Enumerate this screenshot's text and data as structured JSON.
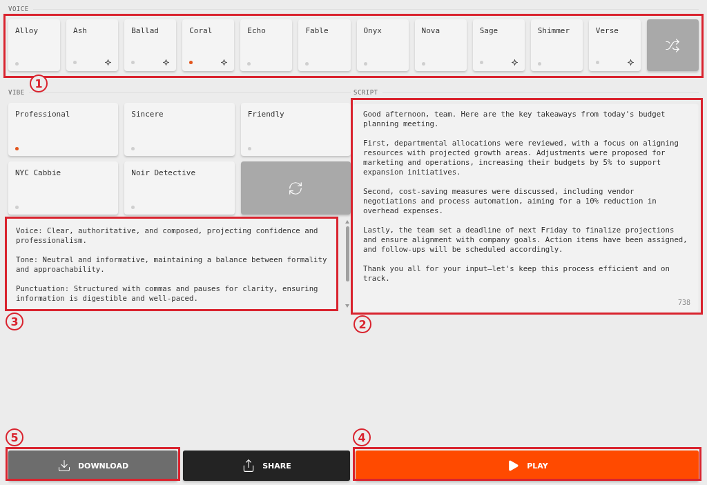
{
  "voice": {
    "heading": "VOICE",
    "annotation": "1",
    "options": [
      {
        "name": "Alloy",
        "selected": false,
        "sparkle": false
      },
      {
        "name": "Ash",
        "selected": false,
        "sparkle": true
      },
      {
        "name": "Ballad",
        "selected": false,
        "sparkle": true
      },
      {
        "name": "Coral",
        "selected": true,
        "sparkle": true
      },
      {
        "name": "Echo",
        "selected": false,
        "sparkle": false
      },
      {
        "name": "Fable",
        "selected": false,
        "sparkle": false
      },
      {
        "name": "Onyx",
        "selected": false,
        "sparkle": false
      },
      {
        "name": "Nova",
        "selected": false,
        "sparkle": false
      },
      {
        "name": "Sage",
        "selected": false,
        "sparkle": true
      },
      {
        "name": "Shimmer",
        "selected": false,
        "sparkle": false
      },
      {
        "name": "Verse",
        "selected": false,
        "sparkle": true
      }
    ]
  },
  "vibe": {
    "heading": "VIBE",
    "options": [
      {
        "name": "Professional",
        "selected": true
      },
      {
        "name": "Sincere",
        "selected": false
      },
      {
        "name": "Friendly",
        "selected": false
      },
      {
        "name": "NYC Cabbie",
        "selected": false
      },
      {
        "name": "Noir Detective",
        "selected": false
      }
    ],
    "description": {
      "annotation": "3",
      "paragraphs": [
        "Voice: Clear, authoritative, and composed, projecting confidence and professionalism.",
        "Tone: Neutral and informative, maintaining a balance between formality and approachability.",
        "Punctuation: Structured with commas and pauses for clarity, ensuring information is digestible and well-paced."
      ]
    }
  },
  "script": {
    "heading": "SCRIPT",
    "annotation": "2",
    "paragraphs": [
      "Good afternoon, team. Here are the key takeaways from today's budget planning meeting.",
      "First, departmental allocations were reviewed, with a focus on aligning resources with projected growth areas. Adjustments were proposed for marketing and operations, increasing their budgets by 5% to support expansion initiatives.",
      "Second, cost-saving measures were discussed, including vendor negotiations and process automation, aiming for a 10% reduction in overhead expenses.",
      "Lastly, the team set a deadline of next Friday to finalize projections and ensure alignment with company goals. Action items have been assigned, and follow-ups will be scheduled accordingly.",
      "Thank you all for your input—let's keep this process efficient and on track."
    ],
    "char_count": "738"
  },
  "actions": [
    {
      "kind": "download",
      "label": "DOWNLOAD",
      "annotation": "5"
    },
    {
      "kind": "share",
      "label": "SHARE"
    },
    {
      "kind": "play",
      "label": "PLAY",
      "annotation": "4"
    }
  ]
}
